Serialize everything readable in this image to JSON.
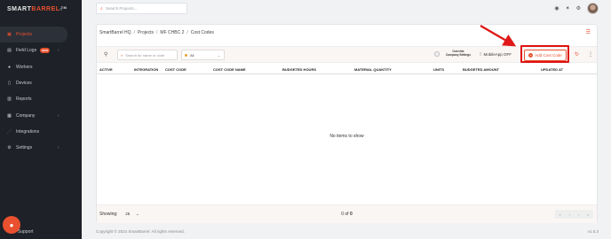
{
  "app": {
    "logo_prefix": "SMART",
    "logo_accent": "BARREL",
    "logo_tm": "TM",
    "brand_color": "#e8502f"
  },
  "sidebar": {
    "items": [
      {
        "label": "Projects",
        "icon": "folder-icon",
        "active": true
      },
      {
        "label": "Field Logs",
        "icon": "clipboard-icon",
        "badge": "NEW",
        "has_chevron": true
      },
      {
        "label": "Workers",
        "icon": "person-icon"
      },
      {
        "label": "Devices",
        "icon": "phone-icon"
      },
      {
        "label": "Reports",
        "icon": "chart-icon"
      },
      {
        "label": "Company",
        "icon": "building-icon",
        "has_chevron": true
      },
      {
        "label": "Integrations",
        "icon": "share-icon"
      },
      {
        "label": "Settings",
        "icon": "gear-icon",
        "has_chevron": true
      }
    ],
    "support_label": "Support"
  },
  "header": {
    "search_placeholder": "Search Projects..."
  },
  "breadcrumb": [
    "SmartBarrel HQ",
    "Projects",
    "MF CHBC 2",
    "Cost Codes"
  ],
  "toolbar": {
    "search_placeholder": "Search for name or code",
    "status_value": "All",
    "override_label_line1": "Override",
    "override_label_line2": "Company Settings",
    "mobile_app_label": "MobileApp OFF",
    "add_button_label": "Add Cost Code"
  },
  "table": {
    "columns": [
      "ACTIVE",
      "INTEGRATION",
      "COST CODE",
      "COST CODE NAME",
      "BUDGETED HOURS",
      "MATERIAL QUANTITY",
      "UNITS",
      "BUDGETED AMOUNT",
      "UPDATED AT"
    ],
    "empty_message": "No items to show"
  },
  "footer": {
    "showing_label": "Showing:",
    "page_size": "25",
    "count_prefix": "0 of ",
    "count_total": "0"
  },
  "page_footer": {
    "copyright": "Copyright © 2024 SmartBarrel. All rights reserved.",
    "version": "v1.6.3"
  }
}
